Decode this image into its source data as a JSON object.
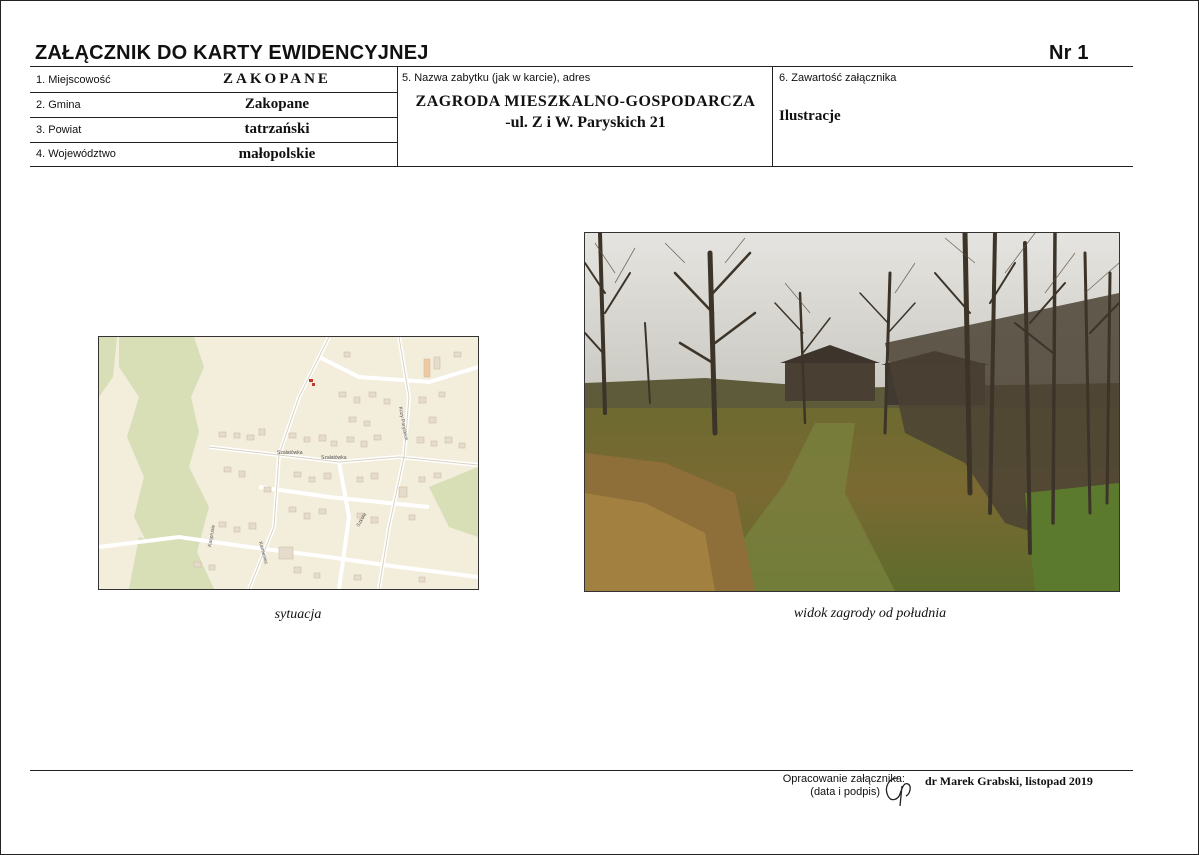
{
  "header": {
    "title": "ZAŁĄCZNIK DO KARTY EWIDENCYJNEJ",
    "number": "Nr 1"
  },
  "fields": {
    "miejscowosc": {
      "label": "1. Miejscowość",
      "value": "ZAKOPANE"
    },
    "gmina": {
      "label": "2. Gmina",
      "value": "Zakopane"
    },
    "powiat": {
      "label": "3. Powiat",
      "value": "tatrzański"
    },
    "wojewodztwo": {
      "label": "4. Województwo",
      "value": "małopolskie"
    },
    "zabytek": {
      "label": "5. Nazwa zabytku (jak w karcie), adres",
      "name": "ZAGRODA MIESZKALNO-GOSPODARCZA",
      "address": "-ul. Z i W. Paryskich 21"
    },
    "zawartosc": {
      "label": "6. Zawartość załącznika",
      "value": "Ilustracje"
    }
  },
  "illustrations": {
    "map": {
      "caption": "sytuacja",
      "street_labels": [
        "Szkoła",
        "Szałatówka",
        "Szałatówka",
        "Kozy Paryskich",
        "Kamieniec",
        "Kasprusie"
      ]
    },
    "photo": {
      "caption": "widok zagrody od południa"
    }
  },
  "footer": {
    "prepared_label": "Opracowanie załącznika:",
    "sign_label": "(data i podpis)",
    "author": "dr Marek Grabski, listopad 2019"
  },
  "colors": {
    "map_background": "#f3eddc",
    "map_forest": "#d8dfb6",
    "map_roads": "#ffffff",
    "map_buildings": "#e6dccb",
    "map_marker": "#c0392b"
  }
}
